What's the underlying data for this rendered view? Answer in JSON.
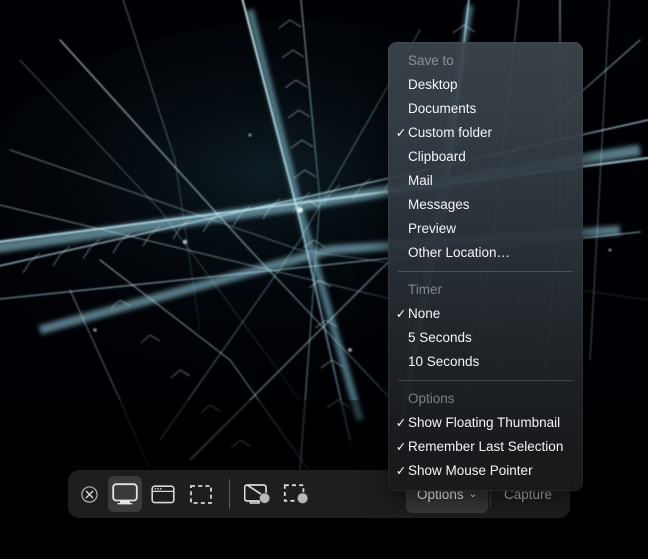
{
  "desktop": {
    "wallpaper_name": "ice-crystal-frost-wallpaper",
    "background_color": "#000000",
    "crystal_color": "#cfeff8"
  },
  "toolbar": {
    "name": "screenshot-toolbar",
    "close_label": "Close",
    "buttons": [
      {
        "id": "capture-entire-screen",
        "label": "Capture Entire Screen",
        "icon": "screen-icon",
        "selected": true
      },
      {
        "id": "capture-selected-window",
        "label": "Capture Selected Window",
        "icon": "window-icon",
        "selected": false
      },
      {
        "id": "capture-selected-portion",
        "label": "Capture Selected Portion",
        "icon": "selection-icon",
        "selected": false
      },
      {
        "id": "record-entire-screen",
        "label": "Record Entire Screen",
        "icon": "screen-record-icon",
        "selected": false
      },
      {
        "id": "record-selected-portion",
        "label": "Record Selected Portion",
        "icon": "selection-record-icon",
        "selected": false
      }
    ],
    "options_label": "Options",
    "options_caret": "⌄",
    "capture_label": "Capture"
  },
  "options_menu": {
    "sections": [
      {
        "header": "Save to",
        "items": [
          {
            "label": "Desktop",
            "checked": false
          },
          {
            "label": "Documents",
            "checked": false
          },
          {
            "label": "Custom folder",
            "checked": true
          },
          {
            "label": "Clipboard",
            "checked": false
          },
          {
            "label": "Mail",
            "checked": false
          },
          {
            "label": "Messages",
            "checked": false
          },
          {
            "label": "Preview",
            "checked": false
          },
          {
            "label": "Other Location…",
            "checked": false
          }
        ]
      },
      {
        "header": "Timer",
        "items": [
          {
            "label": "None",
            "checked": true
          },
          {
            "label": "5 Seconds",
            "checked": false
          },
          {
            "label": "10 Seconds",
            "checked": false
          }
        ]
      },
      {
        "header": "Options",
        "items": [
          {
            "label": "Show Floating Thumbnail",
            "checked": true
          },
          {
            "label": "Remember Last Selection",
            "checked": true
          },
          {
            "label": "Show Mouse Pointer",
            "checked": true
          }
        ]
      }
    ],
    "check_glyph": "✓"
  }
}
